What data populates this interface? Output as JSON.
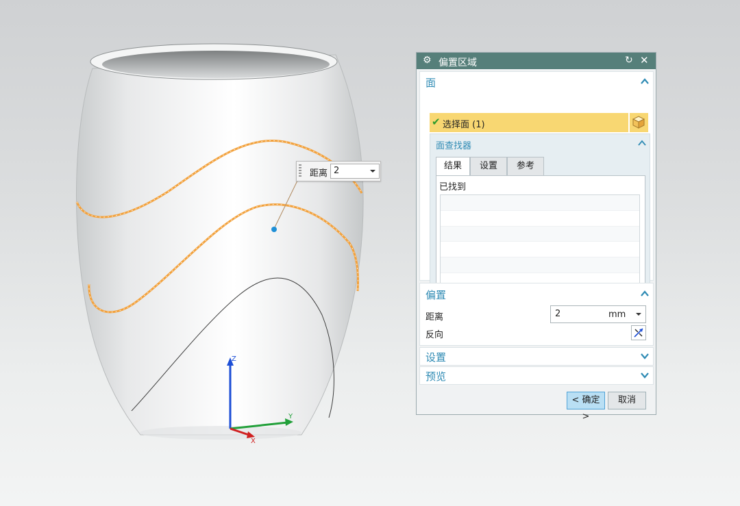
{
  "viewport": {
    "float_input": {
      "label": "距离",
      "value": "2"
    },
    "triad": {
      "x_label": "X",
      "y_label": "Y",
      "z_label": "Z"
    }
  },
  "dialog": {
    "title": "偏置区域",
    "face_section": {
      "title": "面",
      "select_face_label": "选择面 (1)",
      "finder": {
        "title": "面查找器",
        "tabs": [
          "结果",
          "设置",
          "参考"
        ],
        "found_label": "已找到"
      }
    },
    "offset_section": {
      "title": "偏置",
      "distance_label": "距离",
      "distance_value": "2",
      "distance_unit": "mm",
      "reverse_label": "反向"
    },
    "settings_section": {
      "title": "设置"
    },
    "preview_section": {
      "title": "预览"
    },
    "ok_label": "< 确定 >",
    "cancel_label": "取消"
  },
  "colors": {
    "titlebar": "#567f7a",
    "section_title": "#2f8bb4",
    "selection_row": "#f8d772",
    "edge_highlight": "#f2a13c"
  }
}
